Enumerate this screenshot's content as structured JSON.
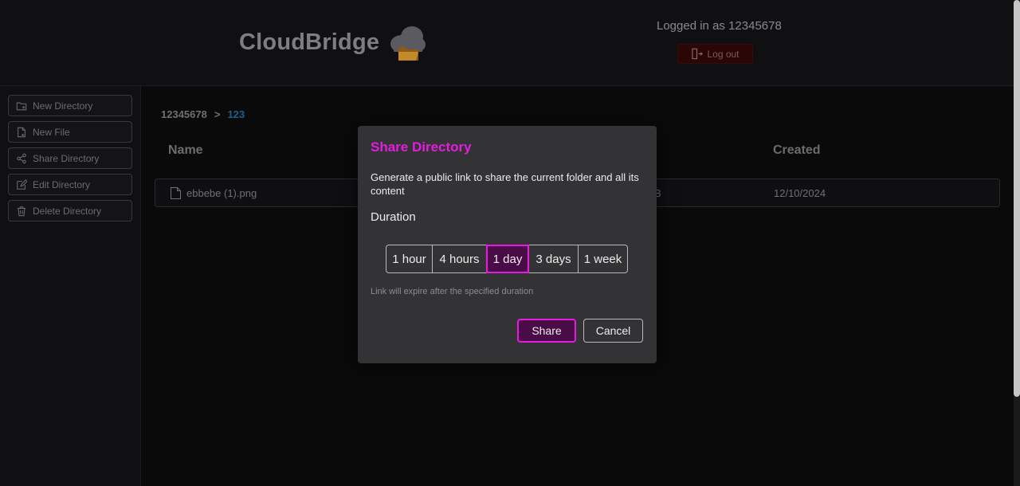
{
  "header": {
    "brand": "CloudBridge",
    "logo_icon": "cloud-folder-icon",
    "user_text": "Logged in as 12345678",
    "logout_label": "Log out"
  },
  "sidebar": {
    "items": [
      {
        "label": "New Directory",
        "icon": "folder-plus-icon"
      },
      {
        "label": "New File",
        "icon": "file-plus-icon"
      },
      {
        "label": "Share Directory",
        "icon": "share-icon"
      },
      {
        "label": "Edit Directory",
        "icon": "edit-icon"
      },
      {
        "label": "Delete Directory",
        "icon": "trash-icon"
      }
    ]
  },
  "breadcrumb": {
    "root": "12345678",
    "separator": ">",
    "current": "123"
  },
  "table": {
    "columns": [
      "Name",
      "Created"
    ],
    "rows": [
      {
        "name": "ebbebe (1).png",
        "size": "B",
        "created": "12/10/2024"
      }
    ]
  },
  "modal": {
    "title": "Share Directory",
    "description": "Generate a public link to share the current folder and all its content",
    "duration_label": "Duration",
    "durations": [
      "1 hour",
      "4 hours",
      "1 day",
      "3 days",
      "1 week"
    ],
    "selected_duration": "1 day",
    "hint": "Link will expire after the specified duration",
    "share_label": "Share",
    "cancel_label": "Cancel"
  },
  "colors": {
    "accent": "#e51ce0",
    "accent_bg": "#4a0c47",
    "breadcrumb_current": "#1d5f8c",
    "logout_bg": "#2a0606"
  }
}
